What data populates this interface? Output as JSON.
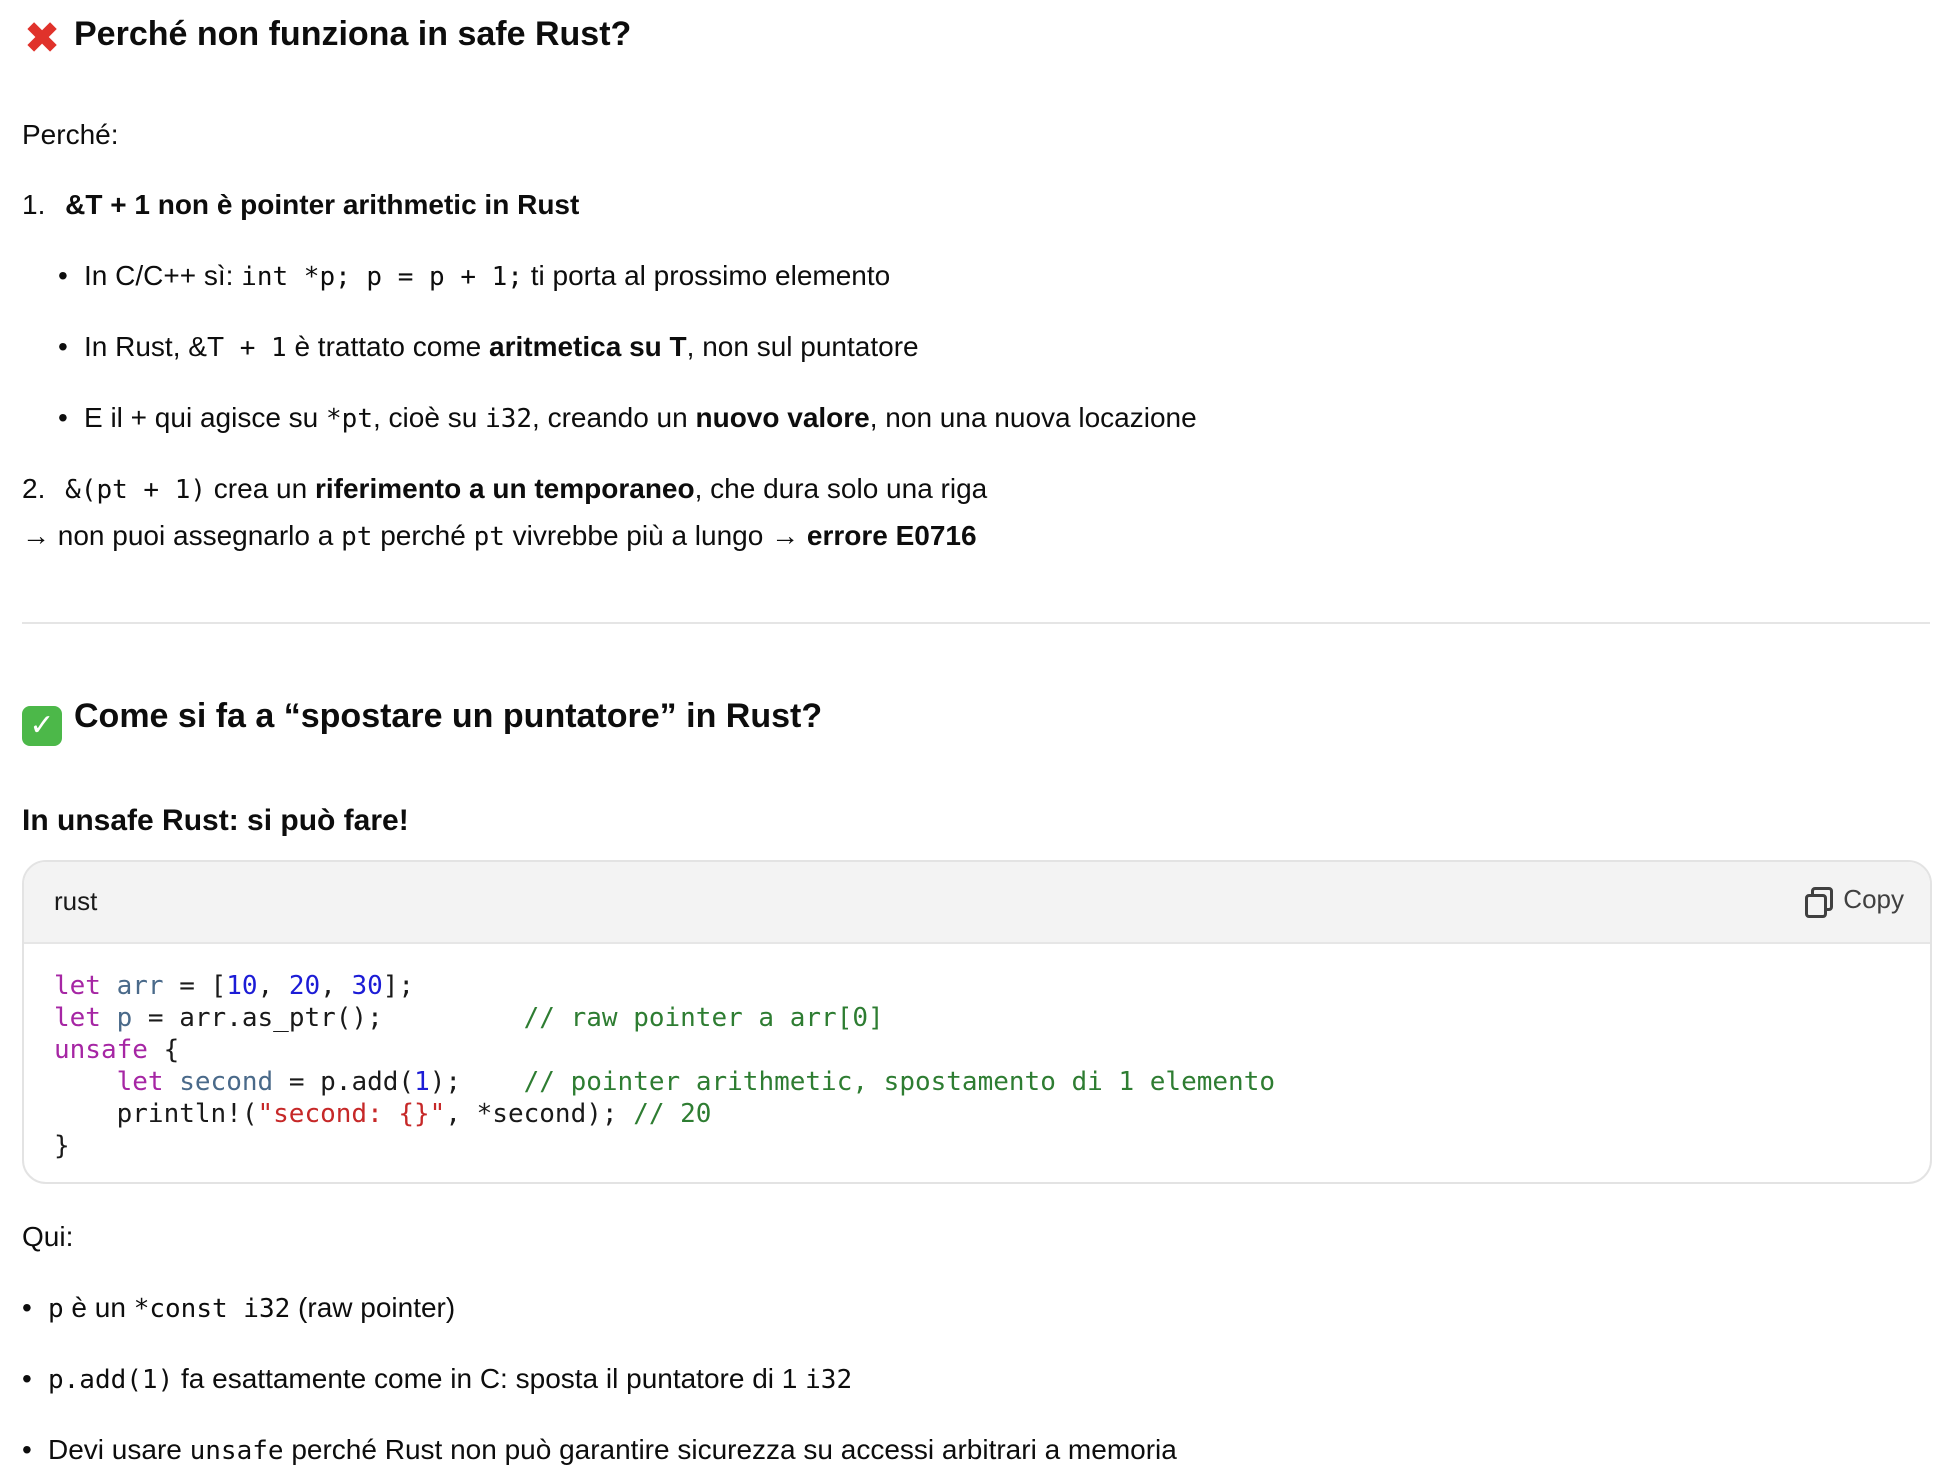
{
  "section1": {
    "title": "Perché non funziona in safe Rust?",
    "icon": "cross-mark-icon",
    "intro": "Perché:",
    "item1": {
      "num": "1.",
      "title": "&T + 1 non è pointer arithmetic in Rust",
      "bullets": [
        {
          "pre": "In C/C++ sì: ",
          "code": "int *p; p = p + 1;",
          "post": " ti porta al prossimo elemento"
        },
        {
          "pre": "In Rust, ",
          "code_a": "&T",
          "code": " + 1",
          "mid": " è trattato come ",
          "bold": "aritmetica su T",
          "post": ", non sul puntatore"
        },
        {
          "pre": "E il + qui agisce su ",
          "code1": "*pt",
          "mid1": ", cioè su ",
          "code2": "i32",
          "mid2": ", creando un ",
          "bold": "nuovo valore",
          "post": ", non una nuova locazione"
        }
      ]
    },
    "item2": {
      "num": "2.",
      "code": "&(pt + 1)",
      "mid": " crea un ",
      "bold": "riferimento a un temporaneo",
      "post": ", che dura solo una riga",
      "line2_pre": "→ non puoi assegnarlo a ",
      "line2_code1": "pt",
      "line2_mid": " perché ",
      "line2_code2": "pt",
      "line2_post": " vivrebbe più a lungo → ",
      "line2_bold": "errore E0716"
    }
  },
  "section2": {
    "title": "Come si fa a “spostare un puntatore” in Rust?",
    "icon": "check-mark-icon",
    "subtitle": "In unsafe Rust: si può fare!",
    "code_block": {
      "language": "rust",
      "copy_label": "Copy",
      "lines": [
        [
          [
            "kw",
            "let"
          ],
          [
            "t",
            " "
          ],
          [
            "id",
            "arr"
          ],
          [
            "t",
            " = ["
          ],
          [
            "num",
            "10"
          ],
          [
            "t",
            ", "
          ],
          [
            "num",
            "20"
          ],
          [
            "t",
            ", "
          ],
          [
            "num",
            "30"
          ],
          [
            "t",
            "];"
          ]
        ],
        [
          [
            "kw",
            "let"
          ],
          [
            "t",
            " "
          ],
          [
            "id",
            "p"
          ],
          [
            "t",
            " = arr.as_ptr();         "
          ],
          [
            "cm",
            "// raw pointer a arr[0]"
          ]
        ],
        [
          [
            "kw",
            "unsafe"
          ],
          [
            "t",
            " {"
          ]
        ],
        [
          [
            "t",
            "    "
          ],
          [
            "kw",
            "let"
          ],
          [
            "t",
            " "
          ],
          [
            "id",
            "second"
          ],
          [
            "t",
            " = p.add("
          ],
          [
            "num",
            "1"
          ],
          [
            "t",
            ");    "
          ],
          [
            "cm",
            "// pointer arithmetic, spostamento di 1 elemento"
          ]
        ],
        [
          [
            "t",
            "    println!("
          ],
          [
            "str",
            "\"second: {}\""
          ],
          [
            "t",
            ", *second); "
          ],
          [
            "cm",
            "// 20"
          ]
        ],
        [
          [
            "t",
            "}"
          ]
        ]
      ]
    },
    "qui": "Qui:",
    "bullets": [
      {
        "code1": "p",
        "mid": " è un ",
        "code2": "*const i32",
        "post": " (raw pointer)"
      },
      {
        "code1": "p.add(1)",
        "mid": " fa esattamente come in C: sposta il puntatore di 1 ",
        "code2": "i32",
        "post": ""
      },
      {
        "pre": "Devi usare ",
        "code1": "unsafe",
        "post": " perché Rust non può garantire sicurezza su accessi arbitrari a memoria"
      }
    ]
  }
}
